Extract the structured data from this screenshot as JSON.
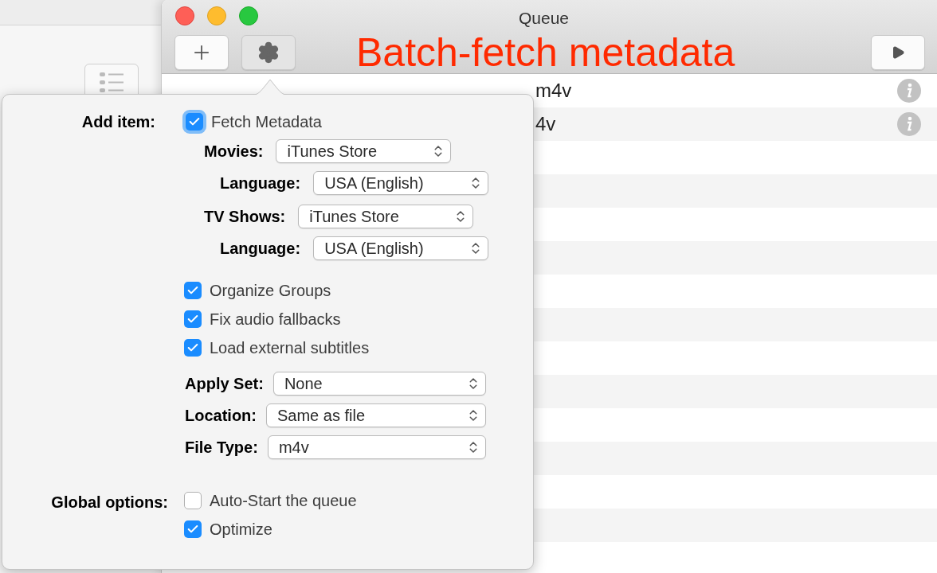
{
  "window": {
    "title": "Queue"
  },
  "toolbar": {
    "buttons": [
      {
        "kind": "add"
      },
      {
        "kind": "settings",
        "selected": true
      },
      {
        "kind": "start"
      }
    ]
  },
  "annotation": "Batch-fetch metadata",
  "queue": {
    "rows": [
      {
        "name": "m4v"
      },
      {
        "name": "4v"
      }
    ]
  },
  "popover": {
    "add_item": {
      "label": "Add item:",
      "checkbox": {
        "label": "Fetch Metadata",
        "checked": true,
        "focused": true
      }
    },
    "metadata_sources": [
      {
        "kind": "source",
        "label": "Movies:",
        "value": "iTunes Store"
      },
      {
        "kind": "language",
        "label": "Language:",
        "value": "USA (English)"
      },
      {
        "kind": "source",
        "label": "TV Shows:",
        "value": "iTunes Store"
      },
      {
        "kind": "language",
        "label": "Language:",
        "value": "USA (English)"
      }
    ],
    "options": [
      {
        "label": "Organize Groups",
        "checked": true
      },
      {
        "label": "Fix audio fallbacks",
        "checked": true
      },
      {
        "label": "Load external subtitles",
        "checked": true
      }
    ],
    "settings": [
      {
        "label": "Apply Set:",
        "value": "None"
      },
      {
        "label": "Location:",
        "value": "Same as file"
      },
      {
        "label": "File Type:",
        "value": "m4v"
      }
    ],
    "global_options": {
      "label": "Global options:",
      "checkboxes": [
        {
          "label": "Auto-Start the queue",
          "checked": false
        },
        {
          "label": "Optimize",
          "checked": true
        }
      ]
    }
  }
}
